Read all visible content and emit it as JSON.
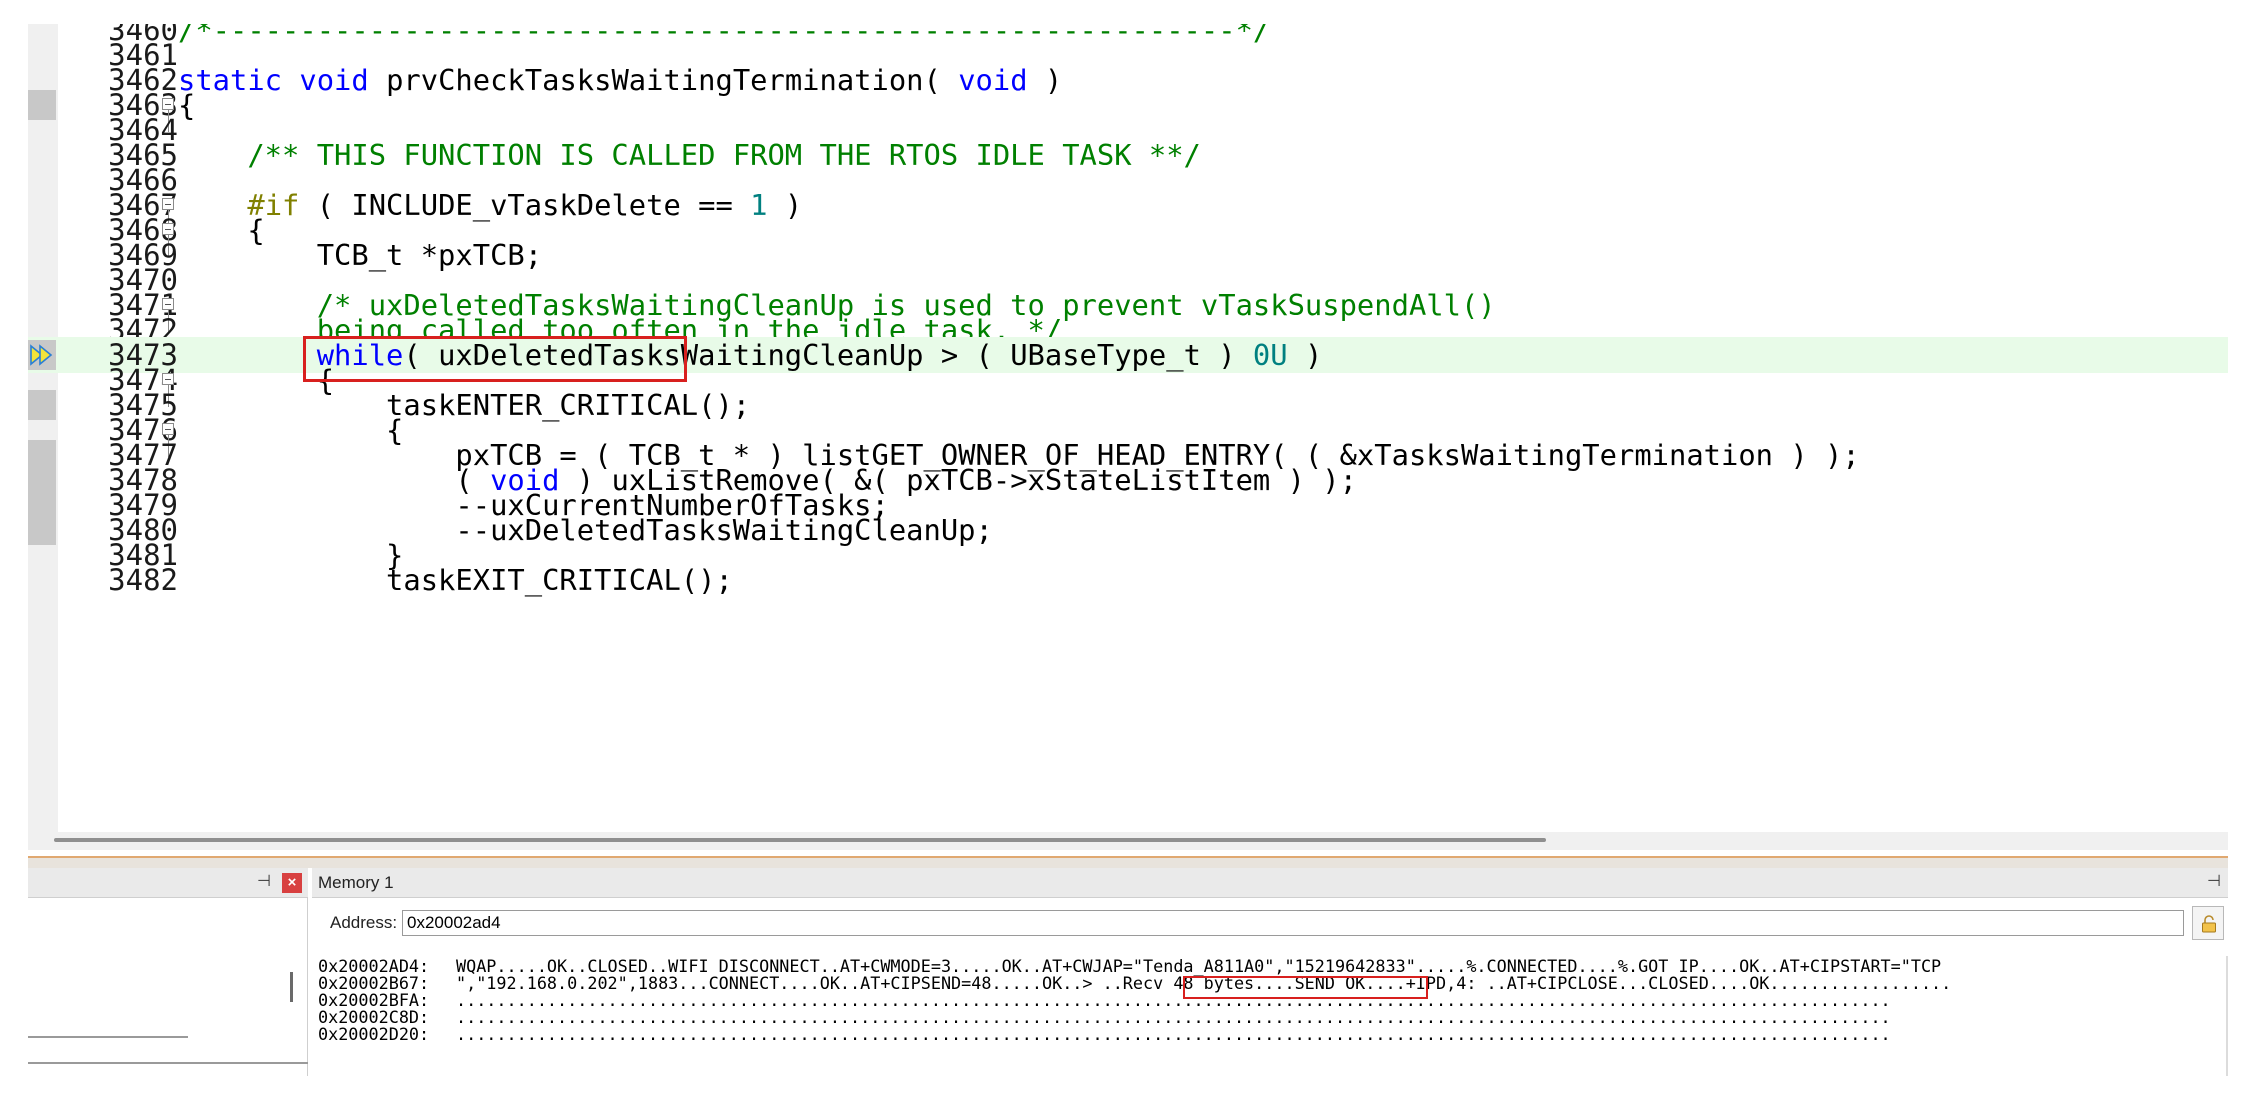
{
  "editor": {
    "lines": [
      {
        "num": "3460",
        "segments": [
          {
            "t": "cm",
            "v": "/*-----------------------------------------------------------*/"
          }
        ]
      },
      {
        "num": "3461",
        "segments": []
      },
      {
        "num": "3462",
        "segments": [
          {
            "t": "kw",
            "v": "static"
          },
          {
            "t": "",
            "v": " "
          },
          {
            "t": "kw",
            "v": "void"
          },
          {
            "t": "",
            "v": " prvCheckTasksWaitingTermination( "
          },
          {
            "t": "kw",
            "v": "void"
          },
          {
            "t": "",
            "v": " )"
          }
        ]
      },
      {
        "num": "3463",
        "segments": [
          {
            "t": "",
            "v": "{"
          }
        ]
      },
      {
        "num": "3464",
        "segments": []
      },
      {
        "num": "3465",
        "segments": [
          {
            "t": "cm",
            "v": "    /** THIS FUNCTION IS CALLED FROM THE RTOS IDLE TASK **/"
          }
        ]
      },
      {
        "num": "3466",
        "segments": []
      },
      {
        "num": "3467",
        "segments": [
          {
            "t": "",
            "v": "    "
          },
          {
            "t": "pp",
            "v": "#if"
          },
          {
            "t": "",
            "v": " ( INCLUDE_vTaskDelete == "
          },
          {
            "t": "num",
            "v": "1"
          },
          {
            "t": "",
            "v": " )"
          }
        ]
      },
      {
        "num": "3468",
        "segments": [
          {
            "t": "",
            "v": "    {"
          }
        ]
      },
      {
        "num": "3469",
        "segments": [
          {
            "t": "",
            "v": "        TCB_t *pxTCB;"
          }
        ]
      },
      {
        "num": "3470",
        "segments": []
      },
      {
        "num": "3471",
        "segments": [
          {
            "t": "cm",
            "v": "        /* uxDeletedTasksWaitingCleanUp is used to prevent vTaskSuspendAll()"
          }
        ]
      },
      {
        "num": "3472",
        "segments": [
          {
            "t": "cm",
            "v": "        being called too often in the idle task. */"
          }
        ]
      },
      {
        "num": "3473",
        "segments": [
          {
            "t": "",
            "v": "        "
          },
          {
            "t": "kw",
            "v": "while"
          },
          {
            "t": "",
            "v": "( uxDeletedTasksWaitingCleanUp > ( UBaseType_t ) "
          },
          {
            "t": "num",
            "v": "0U"
          },
          {
            "t": "",
            "v": " )"
          }
        ]
      },
      {
        "num": "3474",
        "segments": [
          {
            "t": "",
            "v": "        {"
          }
        ]
      },
      {
        "num": "3475",
        "segments": [
          {
            "t": "",
            "v": "            taskENTER_CRITICAL();"
          }
        ]
      },
      {
        "num": "3476",
        "segments": [
          {
            "t": "",
            "v": "            {"
          }
        ]
      },
      {
        "num": "3477",
        "segments": [
          {
            "t": "",
            "v": "                pxTCB = ( TCB_t * ) listGET_OWNER_OF_HEAD_ENTRY( ( &xTasksWaitingTermination ) );"
          }
        ]
      },
      {
        "num": "3478",
        "segments": [
          {
            "t": "",
            "v": "                ( "
          },
          {
            "t": "kw",
            "v": "void"
          },
          {
            "t": "",
            "v": " ) uxListRemove( &( pxTCB->xStateListItem ) );"
          }
        ]
      },
      {
        "num": "3479",
        "segments": [
          {
            "t": "",
            "v": "                --uxCurrentNumberOfTasks;"
          }
        ]
      },
      {
        "num": "3480",
        "segments": [
          {
            "t": "",
            "v": "                --uxDeletedTasksWaitingCleanUp;"
          }
        ]
      },
      {
        "num": "3481",
        "segments": [
          {
            "t": "",
            "v": "            }"
          }
        ]
      },
      {
        "num": "3482",
        "segments": [
          {
            "t": "",
            "v": "            taskEXIT_CRITICAL();"
          }
        ]
      }
    ],
    "current_line": "3473",
    "fold_lines": [
      "3463",
      "3467",
      "3468",
      "3471",
      "3474",
      "3476"
    ],
    "gutter_marks": [
      "3463",
      "3475",
      "3477",
      "3478",
      "3479",
      "3480"
    ]
  },
  "left_panel": {
    "pin_icon": "pin-icon",
    "close_icon": "close-icon"
  },
  "memory": {
    "title": "Memory 1",
    "address_label": "Address:",
    "address_value": "0x20002ad4",
    "lock_icon": "lock-icon",
    "rows": [
      {
        "addr": "0x20002AD4:",
        "data": "WQAP.....OK..CLOSED..WIFI DISCONNECT..AT+CWMODE=3.....OK..AT+CWJAP=\"Tenda_A811A0\",\"15219642833\".....%.CONNECTED....%.GOT IP....OK..AT+CIPSTART=\"TCP"
      },
      {
        "addr": "0x20002B67:",
        "data": "\",\"192.168.0.202\",1883...CONNECT....OK..AT+CIPSEND=48.....OK..> ..Recv 48 bytes....SEND OK....+IPD,4: ..AT+CIPCLOSE...CLOSED....OK.................."
      },
      {
        "addr": "0x20002BFA:",
        "data": ".............................................................................................................................................."
      },
      {
        "addr": "0x20002C8D:",
        "data": ".............................................................................................................................................."
      },
      {
        "addr": "0x20002D20:",
        "data": ".............................................................................................................................................."
      }
    ]
  },
  "colors": {
    "keyword": "#0000ff",
    "comment": "#008000",
    "preprocessor": "#808000",
    "number": "#008080",
    "current_line_bg": "#e8fbe8",
    "highlight_box": "#d8201e"
  }
}
